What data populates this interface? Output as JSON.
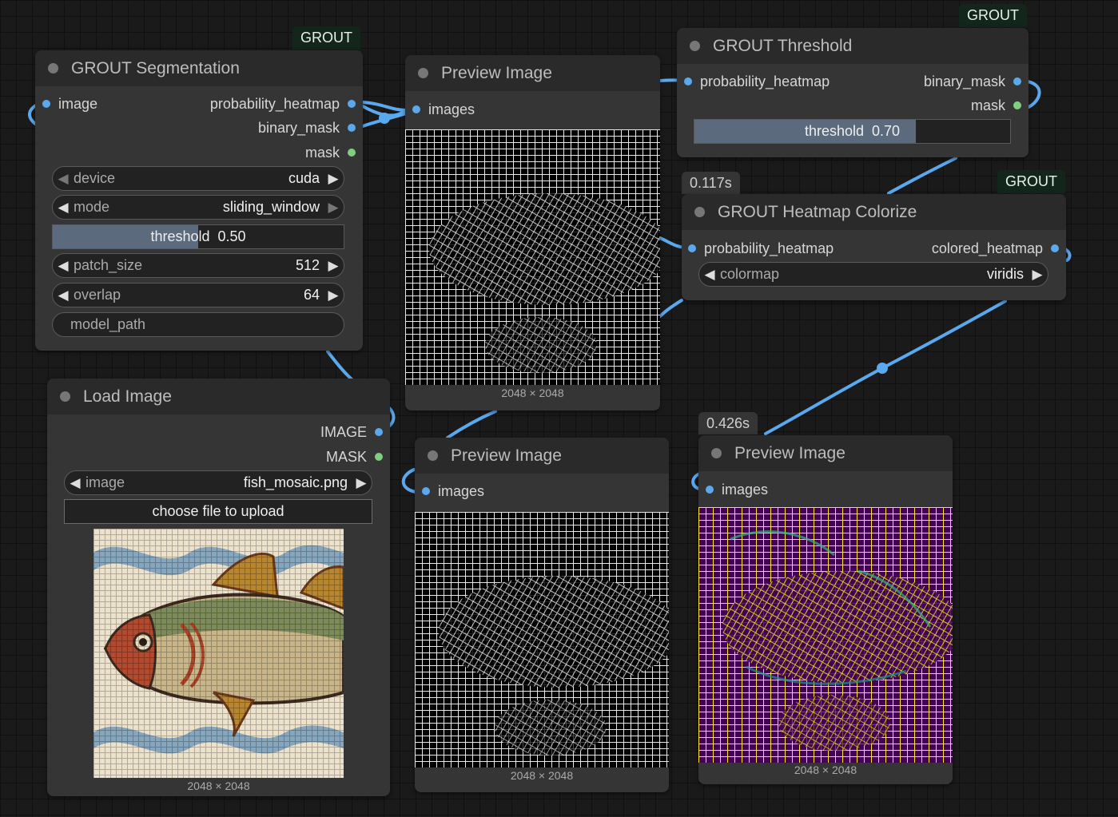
{
  "seg": {
    "badge": "GROUT",
    "title": "GROUT Segmentation",
    "in_image": "image",
    "out_heatmap": "probability_heatmap",
    "out_binary": "binary_mask",
    "out_mask": "mask",
    "device_label": "device",
    "device_value": "cuda",
    "mode_label": "mode",
    "mode_value": "sliding_window",
    "threshold_label": "threshold",
    "threshold_value": "0.50",
    "threshold_fraction": 0.5,
    "patch_label": "patch_size",
    "patch_value": "512",
    "overlap_label": "overlap",
    "overlap_value": "64",
    "model_path_label": "model_path"
  },
  "preview1": {
    "title": "Preview Image",
    "in_images": "images",
    "dims": "2048 × 2048"
  },
  "threshold_node": {
    "badge": "GROUT",
    "title": "GROUT Threshold",
    "in_heatmap": "probability_heatmap",
    "out_binary": "binary_mask",
    "out_mask": "mask",
    "threshold_label": "threshold",
    "threshold_value": "0.70",
    "threshold_fraction": 0.7
  },
  "colorize": {
    "badge": "GROUT",
    "time": "0.117s",
    "title": "GROUT Heatmap Colorize",
    "in_heatmap": "probability_heatmap",
    "out_colored": "colored_heatmap",
    "colormap_label": "colormap",
    "colormap_value": "viridis"
  },
  "load": {
    "title": "Load Image",
    "out_image": "IMAGE",
    "out_mask": "MASK",
    "image_label": "image",
    "image_value": "fish_mosaic.png",
    "upload_label": "choose file to upload",
    "dims": "2048 × 2048"
  },
  "preview2": {
    "title": "Preview Image",
    "in_images": "images",
    "dims": "2048 × 2048"
  },
  "preview3": {
    "time": "0.426s",
    "title": "Preview Image",
    "in_images": "images",
    "dims": "2048 × 2048"
  },
  "colors": {
    "canvas": "#1a1a1a",
    "node_body": "#353535",
    "node_title": "#2a2a2a",
    "link": "#5aa9ee",
    "badge_bg": "#12261b",
    "slider_fill": "#5b6a7d",
    "viridis_dark": "#440154",
    "viridis_yellow": "#fde725"
  }
}
